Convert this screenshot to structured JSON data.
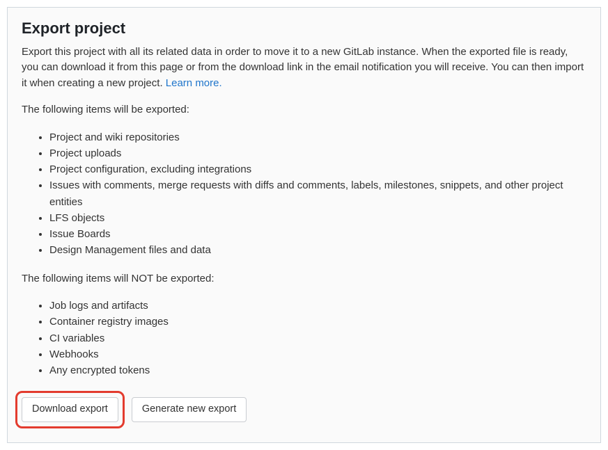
{
  "export": {
    "title": "Export project",
    "description_before_link": "Export this project with all its related data in order to move it to a new GitLab instance. When the exported file is ready, you can download it from this page or from the download link in the email notification you will receive. You can then import it when creating a new project. ",
    "learn_more_label": "Learn more.",
    "will_export_intro": "The following items will be exported:",
    "will_export_items": [
      "Project and wiki repositories",
      "Project uploads",
      "Project configuration, excluding integrations",
      "Issues with comments, merge requests with diffs and comments, labels, milestones, snippets, and other project entities",
      "LFS objects",
      "Issue Boards",
      "Design Management files and data"
    ],
    "wont_export_intro": "The following items will NOT be exported:",
    "wont_export_items": [
      "Job logs and artifacts",
      "Container registry images",
      "CI variables",
      "Webhooks",
      "Any encrypted tokens"
    ],
    "buttons": {
      "download": "Download export",
      "generate": "Generate new export"
    }
  }
}
